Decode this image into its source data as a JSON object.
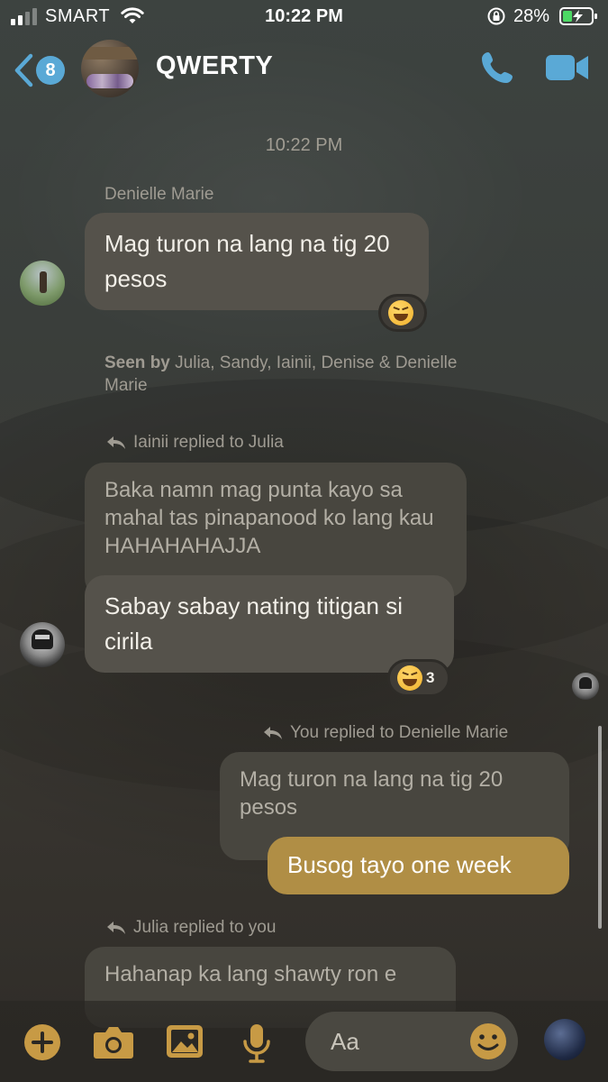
{
  "status_bar": {
    "carrier": "SMART",
    "time": "10:22 PM",
    "battery_percent": "28%"
  },
  "header": {
    "back_badge": "8",
    "title": "QWERTY"
  },
  "thread": {
    "timestamp": "10:22 PM",
    "messages": [
      {
        "sender": "Denielle Marie",
        "text": "Mag turon na lang na tig 20 pesos",
        "reaction": {
          "emoji": "laughing",
          "count": ""
        }
      }
    ],
    "seen": {
      "label": "Seen by",
      "names": "Julia, Sandy, Iainii, Denise & Denielle Marie"
    },
    "reply1": {
      "reply_line": "Iainii replied to Julia",
      "quoted": "Baka namn mag punta kayo sa mahal tas pinapanood ko lang kau HAHAHAHAJJA",
      "text": "Sabay sabay nating titigan si cirila",
      "reaction": {
        "emoji": "laughing",
        "count": "3"
      }
    },
    "reply2": {
      "reply_line": "You replied to Denielle Marie",
      "quoted": "Mag turon na lang na tig 20 pesos",
      "text": "Busog tayo one week"
    },
    "reply3": {
      "reply_line": "Julia replied to you",
      "quoted": "Hahanap ka lang shawty ron e"
    }
  },
  "composer": {
    "placeholder": "Aa"
  },
  "colors": {
    "accent": "#5aa9d6",
    "composer_icons": "#c79a45",
    "my_bubble": "#b08e45",
    "other_bubble": "#55524b"
  },
  "icons": [
    "back-chevron-icon",
    "phone-icon",
    "video-camera-icon",
    "plus-icon",
    "camera-icon",
    "image-icon",
    "microphone-icon",
    "smile-icon",
    "reply-arrow-icon"
  ]
}
